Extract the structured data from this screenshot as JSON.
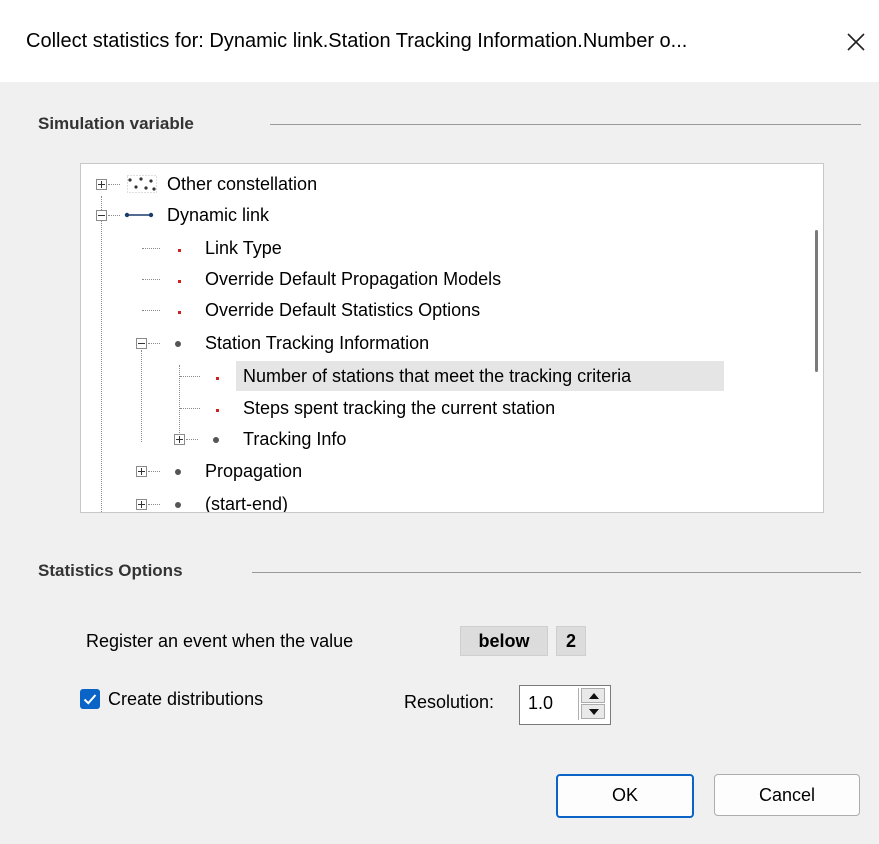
{
  "window": {
    "title": "Collect statistics for: Dynamic link.Station Tracking Information.Number o...",
    "close_icon": "close-icon"
  },
  "simulation_variable": {
    "heading": "Simulation variable",
    "tree": [
      {
        "label": "Other constellation",
        "level": 0,
        "expander": "plus",
        "icon": "constellation-icon"
      },
      {
        "label": "Dynamic link",
        "level": 0,
        "expander": "minus",
        "icon": "link-icon"
      },
      {
        "label": "Link Type",
        "level": 1,
        "icon": "red-dot-icon"
      },
      {
        "label": "Override Default Propagation Models",
        "level": 1,
        "icon": "red-dot-icon"
      },
      {
        "label": "Override Default Statistics Options",
        "level": 1,
        "icon": "red-dot-icon"
      },
      {
        "label": "Station Tracking Information",
        "level": 1,
        "expander": "minus",
        "icon": "gray-dot-icon"
      },
      {
        "label": "Number of stations that meet the tracking criteria",
        "level": 2,
        "icon": "red-dot-icon",
        "selected": true
      },
      {
        "label": "Steps spent tracking the current station",
        "level": 2,
        "icon": "red-dot-icon"
      },
      {
        "label": "Tracking Info",
        "level": 2,
        "expander": "plus",
        "icon": "gray-dot-icon"
      },
      {
        "label": "Propagation",
        "level": 1,
        "expander": "plus",
        "icon": "gray-dot-icon"
      },
      {
        "label": "(start-end)",
        "level": 1,
        "expander": "plus",
        "icon": "gray-dot-icon"
      }
    ]
  },
  "statistics_options": {
    "heading": "Statistics Options",
    "event_label": "Register an event when the value",
    "event_condition": "below",
    "event_value": "2",
    "create_distributions_label": "Create distributions",
    "create_distributions_checked": true,
    "resolution_label": "Resolution:",
    "resolution_value": "1.0"
  },
  "buttons": {
    "ok": "OK",
    "cancel": "Cancel"
  },
  "colors": {
    "accent": "#0a64c8",
    "selection": "#e5e5e5",
    "leaf_bullet": "#d02020"
  }
}
